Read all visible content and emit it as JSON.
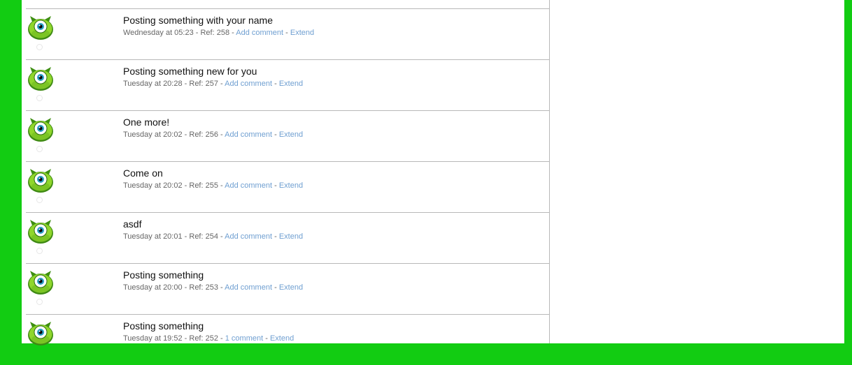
{
  "colors": {
    "frame": "#12cc12",
    "link": "#6f9fd1",
    "meta_text": "#666666",
    "divider": "#b8b8b8"
  },
  "avatar_icon": "green-one-eyed-monster-icon",
  "separator": "-",
  "posts": [
    {
      "title": "Posting something with your name",
      "meta": "Wednesday at 05:23 - Ref: 258 -",
      "comment_link": "Add comment",
      "extend_link": "Extend"
    },
    {
      "title": "Posting something new for you",
      "meta": "Tuesday at 20:28 - Ref: 257 -",
      "comment_link": "Add comment",
      "extend_link": "Extend"
    },
    {
      "title": "One more!",
      "meta": "Tuesday at 20:02 - Ref: 256 -",
      "comment_link": "Add comment",
      "extend_link": "Extend"
    },
    {
      "title": "Come on",
      "meta": "Tuesday at 20:02 - Ref: 255 -",
      "comment_link": "Add comment",
      "extend_link": "Extend"
    },
    {
      "title": "asdf",
      "meta": "Tuesday at 20:01 - Ref: 254 -",
      "comment_link": "Add comment",
      "extend_link": "Extend"
    },
    {
      "title": "Posting something",
      "meta": "Tuesday at 20:00 - Ref: 253 -",
      "comment_link": "Add comment",
      "extend_link": "Extend"
    },
    {
      "title": "Posting something",
      "meta": "Tuesday at 19:52 - Ref: 252 -",
      "comment_link": "1 comment",
      "extend_link": "Extend"
    }
  ]
}
